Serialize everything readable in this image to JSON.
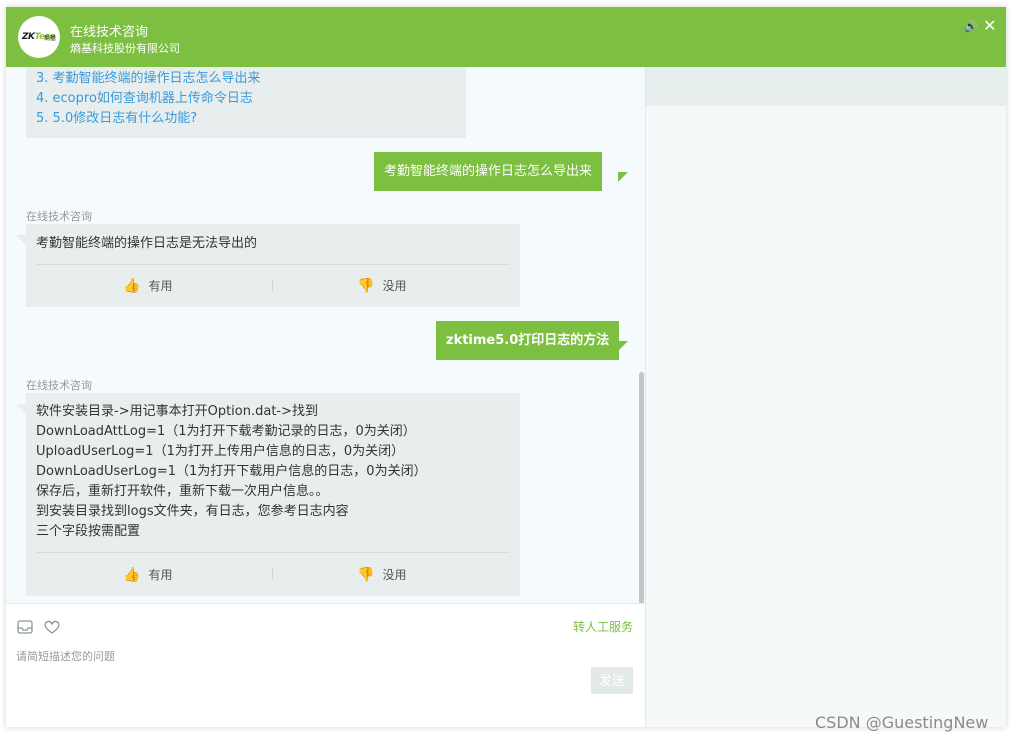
{
  "header": {
    "logo_text_a": "ZK",
    "logo_text_b": "Teco",
    "logo_text_c": "熵基",
    "title": "在线技术咨询",
    "company": "熵基科技股份有限公司",
    "sound_icon": "🔊",
    "close_icon": "✕"
  },
  "suggestions": [
    "3. 考勤智能终端的操作日志怎么导出来",
    "4. ecopro如何查询机器上传命令日志",
    "5. 5.0修改日志有什么功能?"
  ],
  "messages": {
    "user1": "考勤智能终端的操作日志怎么导出来",
    "bot1_sender": "在线技术咨询",
    "bot1_text": "考勤智能终端的操作日志是无法导出的",
    "user2": "zktime5.0打印日志的方法",
    "bot2_sender": "在线技术咨询",
    "bot2_lines": [
      "软件安装目录->用记事本打开Option.dat->找到",
      "DownLoadAttLog=1（1为打开下载考勤记录的日志，0为关闭）",
      "UploadUserLog=1（1为打开上传用户信息的日志，0为关闭）",
      "DownLoadUserLog=1（1为打开下载用户信息的日志，0为关闭）",
      "保存后，重新打开软件，重新下载一次用户信息。。",
      "到安装目录找到logs文件夹，有日志，您参考日志内容",
      "三个字段按需配置"
    ]
  },
  "feedback": {
    "useful": "有用",
    "useless": "没用",
    "thumb_up_icon": "👍",
    "thumb_down_icon": "👎"
  },
  "input": {
    "transfer_label": "转人工服务",
    "placeholder": "请简短描述您的问题",
    "send_label": "发送"
  },
  "watermark": "CSDN @GuestingNew",
  "colors": {
    "brand_green": "#7cbf41",
    "link_blue": "#3a9ad9",
    "bubble_grey": "#e8eeee"
  }
}
